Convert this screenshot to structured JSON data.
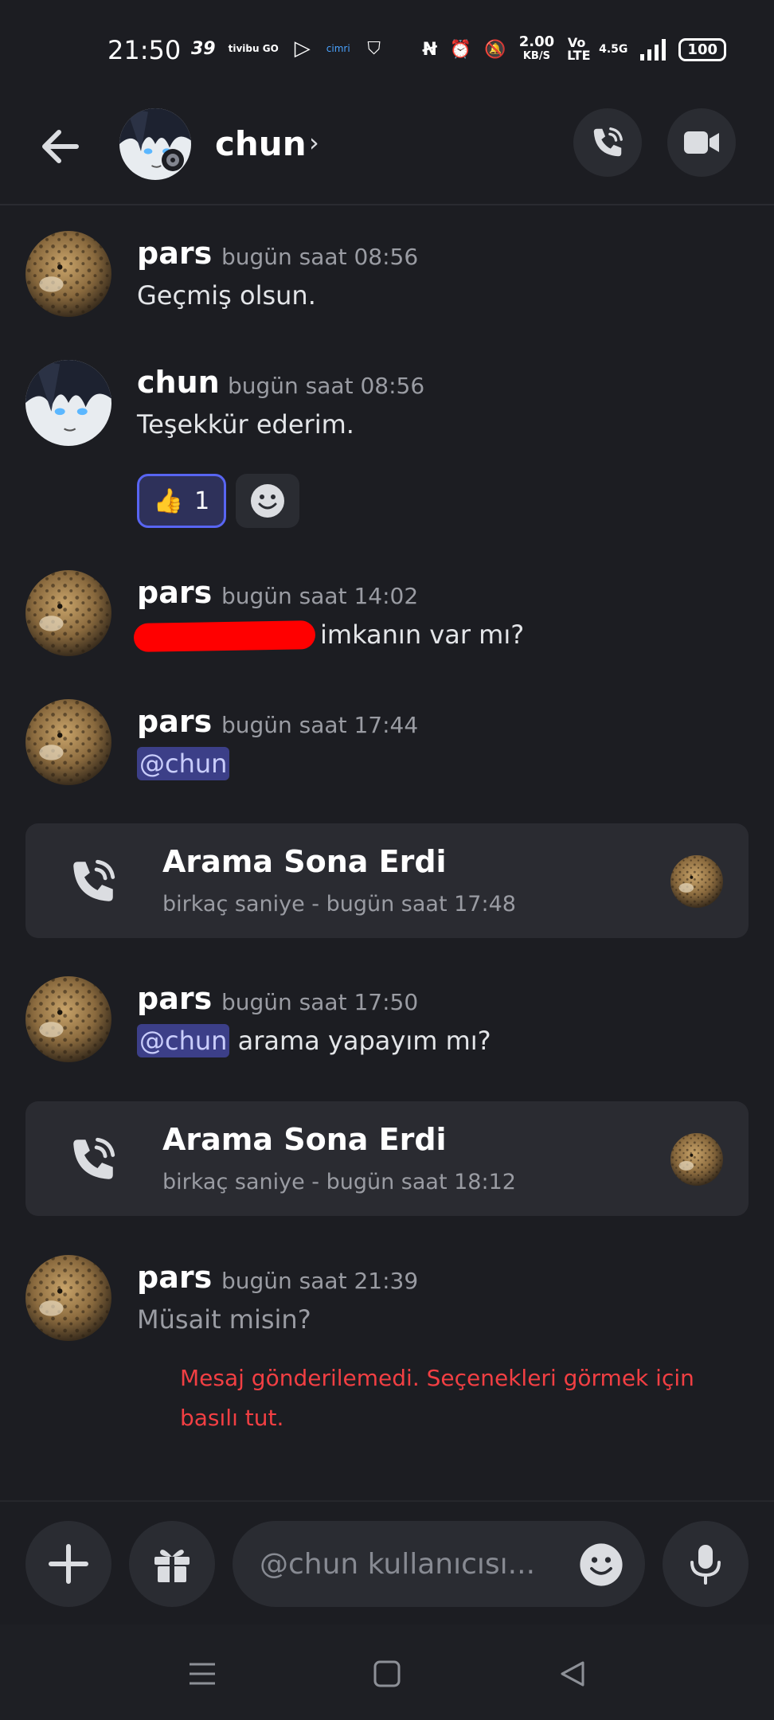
{
  "status_bar": {
    "time": "21:50",
    "left_icons": [
      "39-icon",
      "tivibu-go-icon",
      "play-icon",
      "cimri-icon",
      "shield-icon"
    ],
    "left_icon_labels": [
      "39",
      "tivibu GO",
      "▷",
      "cimri",
      "⛉"
    ],
    "speed": "2.00",
    "speed_unit": "KB/S",
    "volte": "Vo LTE",
    "network": "4.5G",
    "battery": "100"
  },
  "header": {
    "contact_name": "chun",
    "chevron": "›"
  },
  "messages": [
    {
      "author": "pars",
      "time": "bugün saat 08:56",
      "text": "Geçmiş olsun."
    },
    {
      "author": "chun",
      "time": "bugün saat 08:56",
      "text": "Teşekkür ederim.",
      "reaction": {
        "emoji": "👍",
        "count": "1"
      }
    },
    {
      "author": "pars",
      "time": "bugün saat 14:02",
      "text": "imkanın var mı?"
    },
    {
      "author": "pars",
      "time": "bugün saat 17:44",
      "mention": "@chun"
    },
    {
      "author": "pars",
      "time": "bugün saat 17:50",
      "mention": "@chun",
      "text": " arama yapayım mı?"
    },
    {
      "author": "pars",
      "time": "bugün saat 21:39",
      "text": "Müsait misin?"
    }
  ],
  "calls": [
    {
      "title": "Arama Sona Erdi",
      "subtitle": "birkaç saniye - bugün saat 17:48"
    },
    {
      "title": "Arama Sona Erdi",
      "subtitle": "birkaç saniye - bugün saat 18:12"
    }
  ],
  "failed_notice": "Mesaj gönderilemedi. Seçenekleri görmek için basılı tut.",
  "input": {
    "placeholder": "@chun kullanıcısı..."
  },
  "colors": {
    "background": "#1c1d22",
    "accent": "#5865f2",
    "mention_bg": "#3c3f88",
    "error": "#f23f43"
  }
}
